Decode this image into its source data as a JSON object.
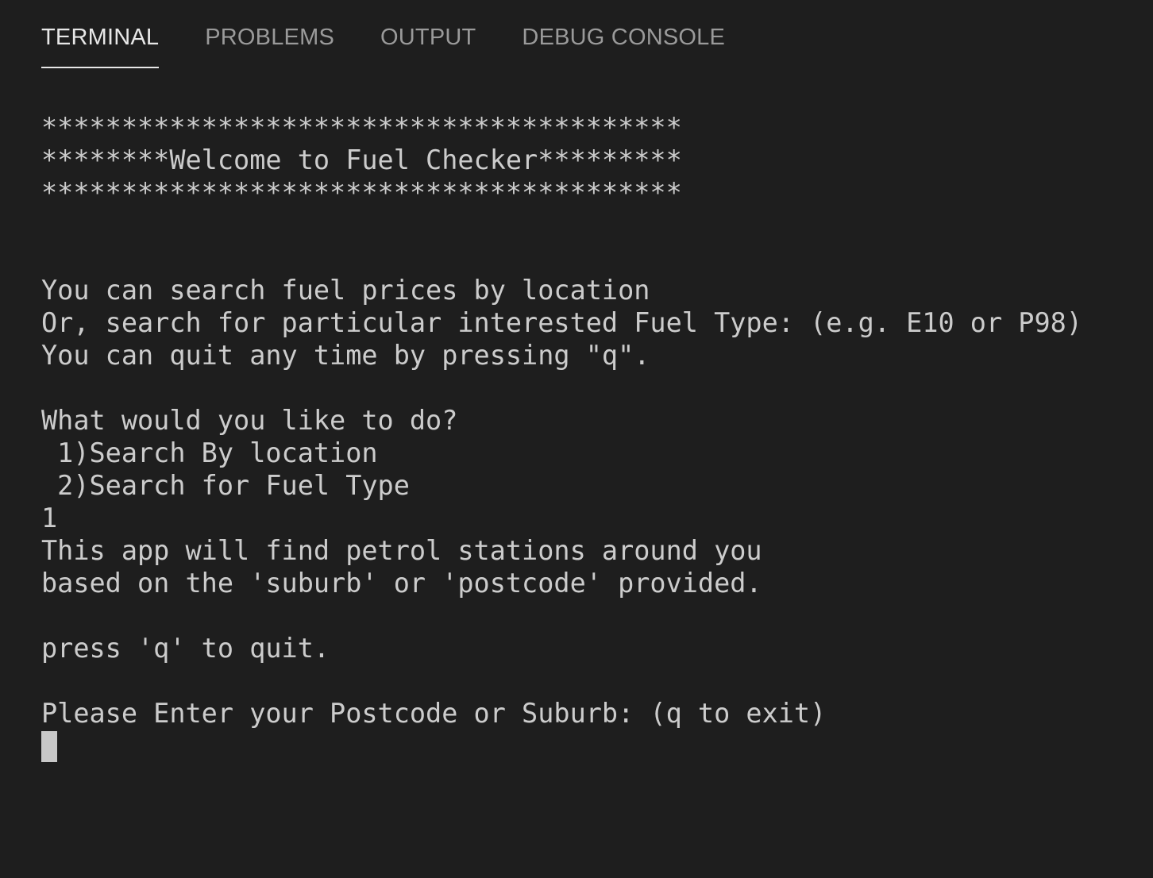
{
  "tabs": [
    {
      "label": "TERMINAL",
      "active": true
    },
    {
      "label": "PROBLEMS",
      "active": false
    },
    {
      "label": "OUTPUT",
      "active": false
    },
    {
      "label": "DEBUG CONSOLE",
      "active": false
    }
  ],
  "terminal": {
    "lines": [
      "****************************************",
      "********Welcome to Fuel Checker*********",
      "****************************************",
      "",
      "",
      "You can search fuel prices by location",
      "Or, search for particular interested Fuel Type: (e.g. E10 or P98)",
      "You can quit any time by pressing \"q\".",
      "",
      "What would you like to do?",
      " 1)Search By location",
      " 2)Search for Fuel Type",
      "1",
      "This app will find petrol stations around you",
      "based on the 'suburb' or 'postcode' provided.",
      "",
      "press 'q' to quit.",
      "",
      "Please Enter your Postcode or Suburb: (q to exit)"
    ]
  },
  "colors": {
    "background": "#1e1e1e",
    "text": "#cccccc",
    "tab_inactive": "#9a9a9a",
    "tab_active": "#e7e7e7",
    "cursor": "#c8c8c8"
  }
}
